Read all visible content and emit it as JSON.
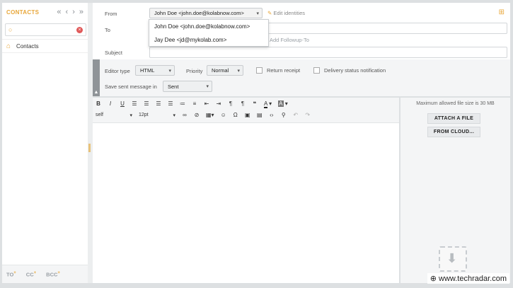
{
  "sidebar": {
    "title": "CONTACTS",
    "nav_icons": [
      "double-left-arrow",
      "left-arrow",
      "right-arrow",
      "double-right-arrow"
    ],
    "search": {
      "value": "",
      "placeholder": ""
    },
    "items": [
      {
        "label": "Contacts"
      }
    ],
    "footer": {
      "to": "TO",
      "cc": "CC",
      "bcc": "BCC",
      "plus": "+"
    }
  },
  "compose": {
    "from_label": "From",
    "from_value": "John Doe <john.doe@kolabnow.com>",
    "edit_identities": "Edit identities",
    "to_label": "To",
    "add_followup": "Add Followup-To",
    "subject_label": "Subject",
    "editor_type_label": "Editor type",
    "editor_type_value": "HTML",
    "priority_label": "Priority",
    "priority_value": "Normal",
    "return_receipt": "Return receipt",
    "delivery_status": "Delivery status notification",
    "save_sent_label": "Save sent message in",
    "save_sent_value": "Sent"
  },
  "identities_dropdown": [
    "John Doe <john.doe@kolabnow.com>",
    "Jay Dee <jd@mykolab.com>"
  ],
  "toolbar": {
    "font_family": "self",
    "font_size": "12pt"
  },
  "attachments": {
    "max_size": "Maximum allowed file size is 30 MB",
    "attach_button": "ATTACH A FILE",
    "cloud_button": "FROM CLOUD..."
  },
  "watermark": "www.techradar.com",
  "colors": {
    "accent": "#e8a73a",
    "background": "#dde0e2"
  }
}
